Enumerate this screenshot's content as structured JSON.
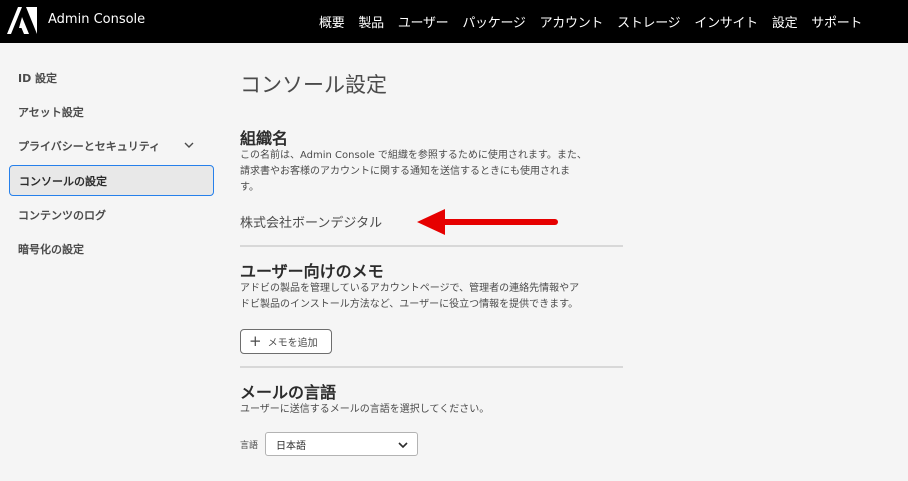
{
  "header": {
    "app_title": "Admin Console",
    "nav": [
      "概要",
      "製品",
      "ユーザー",
      "パッケージ",
      "アカウント",
      "ストレージ",
      "インサイト",
      "設定",
      "サポート"
    ]
  },
  "sidebar": {
    "items": [
      {
        "label": "ID 設定"
      },
      {
        "label": "アセット設定"
      },
      {
        "label": "プライバシーとセキュリティ"
      },
      {
        "label": "コンソールの設定"
      },
      {
        "label": "コンテンツのログ"
      },
      {
        "label": "暗号化の設定"
      }
    ]
  },
  "main": {
    "title": "コンソール設定",
    "org_section": {
      "heading": "組織名",
      "desc_line1": "この名前は、Admin Console で組織を参照するために使用されます。また、",
      "desc_line2": "請求書やお客様のアカウントに関する通知を送信するときにも使用されま",
      "desc_line3": "す。",
      "org_name": "株式会社ボーンデジタル"
    },
    "memo_section": {
      "heading": "ユーザー向けのメモ",
      "desc_line1": "アドビの製品を管理しているアカウントページで、管理者の連絡先情報やア",
      "desc_line2": "ドビ製品のインストール方法など、ユーザーに役立つ情報を提供できます。",
      "add_button": "メモを追加"
    },
    "lang_section": {
      "heading": "メールの言語",
      "desc": "ユーザーに送信するメールの言語を選択してください。",
      "label": "言語",
      "selected": "日本語"
    }
  },
  "colors": {
    "topbar": "#000000",
    "active_border": "#2680eb",
    "annotation_arrow": "#e60000"
  }
}
